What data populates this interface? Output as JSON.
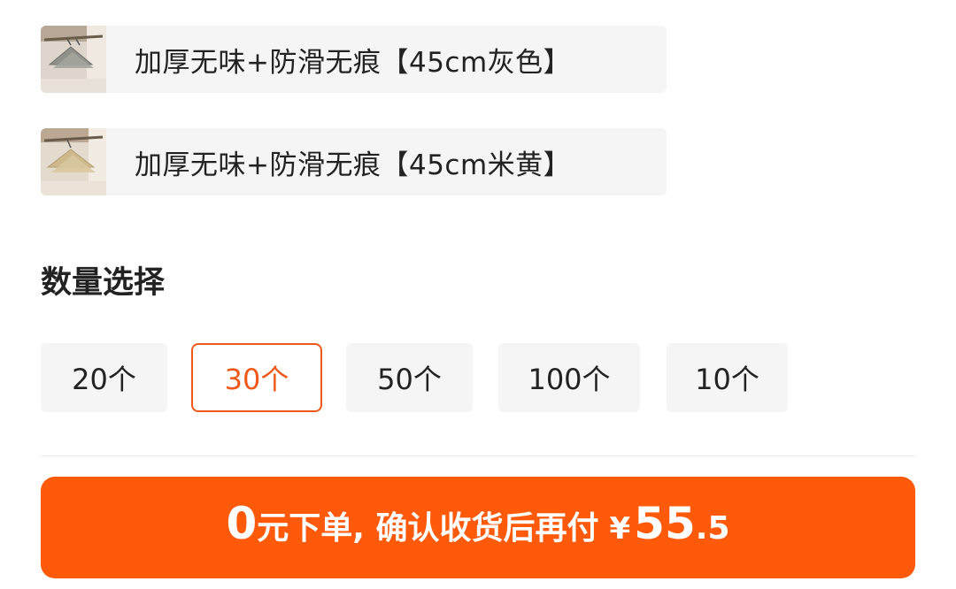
{
  "variants": [
    {
      "label": "加厚无味+防滑无痕【45cm灰色】",
      "thumb_icon": "gray-hanger-thumbnail"
    },
    {
      "label": "加厚无味+防滑无痕【45cm米黄】",
      "thumb_icon": "beige-hanger-thumbnail"
    }
  ],
  "quantity": {
    "title": "数量选择",
    "options": [
      "20个",
      "30个",
      "50个",
      "100个",
      "10个"
    ],
    "selected": "30个"
  },
  "cta": {
    "zero": "0",
    "text": "元下单, 确认收货后再付",
    "currency": "¥",
    "price_int": "55",
    "price_dec": ".5"
  },
  "colors": {
    "accent": "#ff5a0a",
    "selected_border": "#ef5a1a",
    "option_bg": "#f5f5f5",
    "text": "#222222"
  }
}
